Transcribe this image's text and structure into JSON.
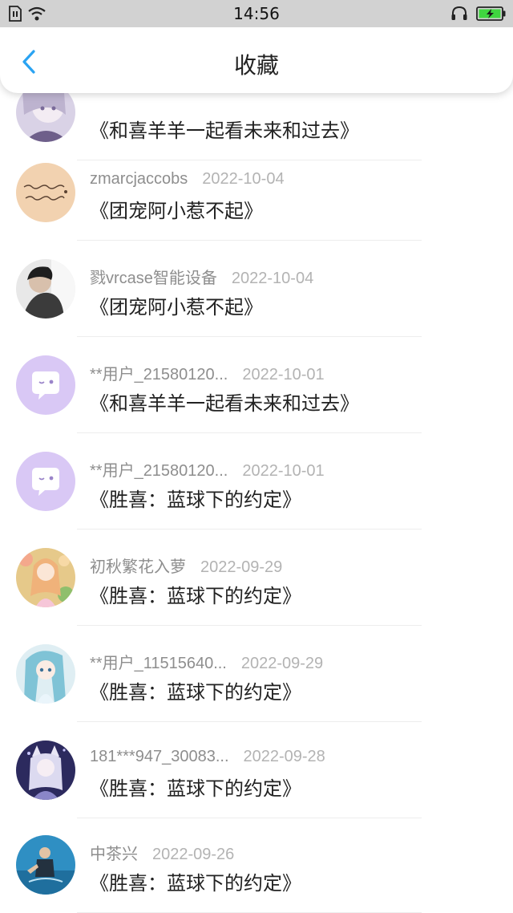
{
  "status_bar": {
    "time": "14:56",
    "icons": [
      "sim-icon",
      "wifi-icon",
      "headset-icon",
      "battery-charging-icon"
    ]
  },
  "header": {
    "title": "收藏",
    "back_icon": "chevron-left-icon",
    "accent_color": "#2aa3f2"
  },
  "favorites": [
    {
      "user": "",
      "date": "",
      "title": "《和喜羊羊一起看未来和过去》",
      "avatar": "anime-girl-lavender"
    },
    {
      "user": "zmarcjaccobs",
      "date": "2022-10-04",
      "title": "《团宠阿小惹不起》",
      "avatar": "handwriting-peach"
    },
    {
      "user": "戮vrcase智能设备",
      "date": "2022-10-04",
      "title": "《团宠阿小惹不起》",
      "avatar": "person-dark"
    },
    {
      "user": "**用户_21580120...",
      "date": "2022-10-01",
      "title": "《和喜羊羊一起看未来和过去》",
      "avatar": "default-chat-bubble"
    },
    {
      "user": "**用户_21580120...",
      "date": "2022-10-01",
      "title": "《胜喜：蓝球下的约定》",
      "avatar": "default-chat-bubble"
    },
    {
      "user": "初秋繁花入萝",
      "date": "2022-09-29",
      "title": "《胜喜：蓝球下的约定》",
      "avatar": "anime-girl-flowers"
    },
    {
      "user": "**用户_11515640...",
      "date": "2022-09-29",
      "title": "《胜喜：蓝球下的约定》",
      "avatar": "anime-girl-teal"
    },
    {
      "user": "181***947_30083...",
      "date": "2022-09-28",
      "title": "《胜喜：蓝球下的约定》",
      "avatar": "anime-fox-girl-night"
    },
    {
      "user": "中茶兴",
      "date": "2022-09-26",
      "title": "《胜喜：蓝球下的约定》",
      "avatar": "person-water"
    }
  ]
}
